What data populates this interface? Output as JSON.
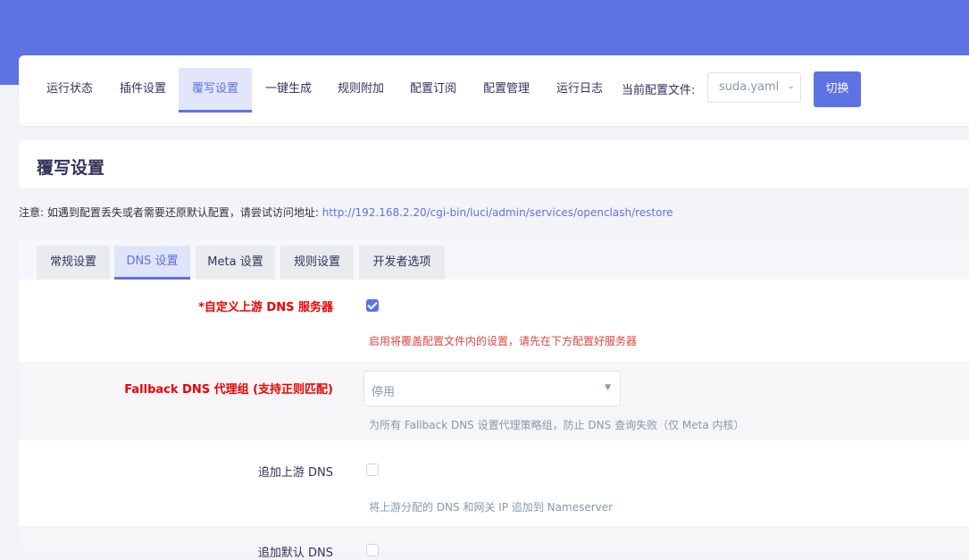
{
  "nav": {
    "tabs": [
      {
        "label": "运行状态"
      },
      {
        "label": "插件设置"
      },
      {
        "label": "覆写设置"
      },
      {
        "label": "一键生成"
      },
      {
        "label": "规则附加"
      },
      {
        "label": "配置订阅"
      },
      {
        "label": "配置管理"
      },
      {
        "label": "运行日志"
      }
    ],
    "active_index": 2,
    "config_label": "当前配置文件:",
    "config_value": "suda.yaml",
    "switch_label": "切换"
  },
  "page": {
    "title": "覆写设置"
  },
  "notice": {
    "text": "注意: 如遇到配置丢失或者需要还原默认配置，请尝试访问地址: ",
    "link": "http://192.168.2.20/cgi-bin/luci/admin/services/openclash/restore"
  },
  "subtabs": [
    {
      "label": "常规设置"
    },
    {
      "label": "DNS 设置"
    },
    {
      "label": "Meta 设置"
    },
    {
      "label": "规则设置"
    },
    {
      "label": "开发者选项"
    }
  ],
  "settings": {
    "custom_dns": {
      "label": "*自定义上游 DNS 服务器",
      "checked": true,
      "desc": "启用将覆盖配置文件内的设置，请先在下方配置好服务器"
    },
    "fallback": {
      "label": "Fallback DNS 代理组 (支持正则匹配)",
      "value": "停用",
      "desc": "为所有 Fallback DNS 设置代理策略组，防止 DNS 查询失败（仅 Meta 内核）"
    },
    "append_dns": {
      "label": "追加上游 DNS",
      "checked": false,
      "desc": "将上游分配的 DNS 和网关 IP 追加到 Nameserver"
    },
    "append_default": {
      "label": "追加默认 DNS",
      "checked": false
    }
  },
  "colors": {
    "accent": "#5e72e4",
    "header": "#5e72e4",
    "required": "#ee0000"
  }
}
